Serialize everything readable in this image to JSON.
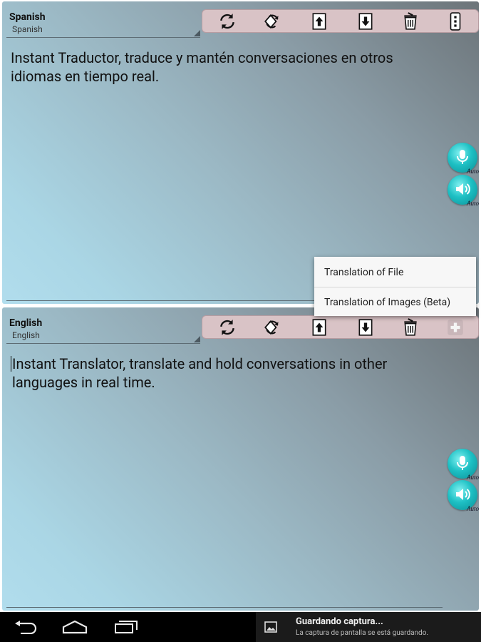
{
  "source_panel": {
    "language_title": "Spanish",
    "language_subtitle": "Spanish",
    "text": "Instant Traductor, traduce y mantén conversaciones en otros idiomas en tiempo real.",
    "mic_auto_label": "Auto",
    "speaker_auto_label": "Auto"
  },
  "target_panel": {
    "language_title": "English",
    "language_subtitle": "English",
    "text": "Instant Translator, translate and hold conversations in other languages in real time.",
    "mic_auto_label": "Auto",
    "speaker_auto_label": "Auto"
  },
  "toolbar_icons": [
    "refresh-icon",
    "swap-icon",
    "upload-icon",
    "download-icon",
    "delete-icon",
    "overflow-menu-icon",
    "add-icon"
  ],
  "popup_menu": {
    "items": [
      {
        "label": "Translation of File"
      },
      {
        "label": "Translation of Images (Beta)"
      }
    ]
  },
  "notification": {
    "title": "Guardando captura...",
    "text": "La captura de pantalla se está guardando."
  },
  "colors": {
    "toolbar_bg": "#d9c3c6",
    "round_button_accent": "#1ec0c4"
  }
}
